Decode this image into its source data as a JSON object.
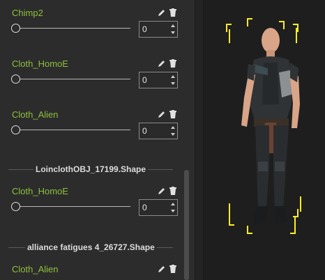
{
  "morph_panel": {
    "sections": [
      {
        "morphs": [
          {
            "name": "Chimp2",
            "value": "0"
          },
          {
            "name": "Cloth_HomoE",
            "value": "0"
          },
          {
            "name": "Cloth_Alien",
            "value": "0"
          }
        ]
      },
      {
        "title": "LoinclothOBJ_17199.Shape",
        "morphs": [
          {
            "name": "Cloth_HomoE",
            "value": "0"
          }
        ]
      },
      {
        "title": "alliance fatigues 4_26727.Shape",
        "morphs": [
          {
            "name": "Cloth_Alien"
          }
        ]
      }
    ]
  },
  "viewport": {
    "subject": "character-figure",
    "selection_color": "#ffee22"
  },
  "colors": {
    "morph_name": "#8fc03c",
    "panel_bg": "#2c2c2c",
    "viewport_bg": "#1e1e1e"
  }
}
